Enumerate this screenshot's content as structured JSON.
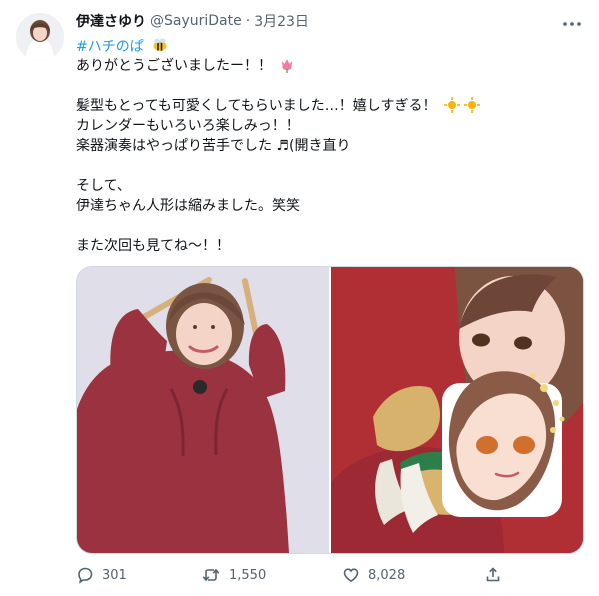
{
  "tweet": {
    "author_name": "伊達さゆり",
    "handle": "@SayuriDate",
    "separator": "·",
    "date": "3月23日",
    "hashtag": "#ハチのぱ",
    "lines": [
      "ありがとうございましたー！！",
      "",
      "髪型もとっても可愛くしてもらいました…！嬉しすぎる！",
      "カレンダーもいろいろ楽しみっ！！",
      "楽器演奏はやっぱり苦手でした ♬(開き直り",
      "",
      "そして、",
      "伊達ちゃん人形は縮みました。笑笑",
      "",
      "また次回も見てね〜！！"
    ],
    "emoji": [
      "bee-icon",
      "tulip-icon",
      "sun-icon"
    ]
  },
  "actions": {
    "replies": "301",
    "retweets": "1,550",
    "likes": "8,028"
  },
  "colors": {
    "accent": "#1d9bf0",
    "muted": "#536471",
    "border": "#cfd9de"
  }
}
